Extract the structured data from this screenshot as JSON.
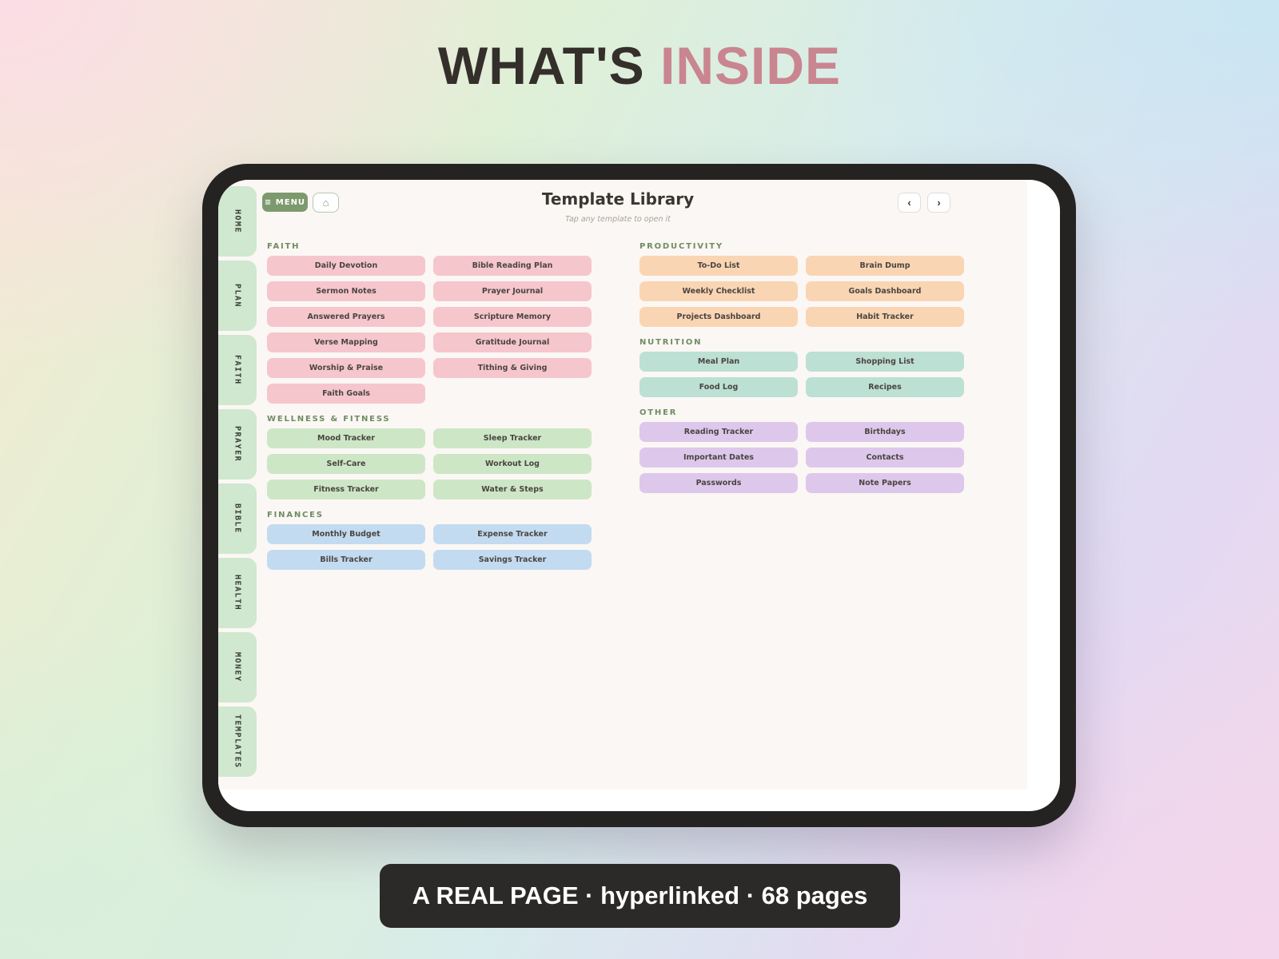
{
  "headline": {
    "main": "WHAT'S",
    "accent": "INSIDE"
  },
  "caption": "A REAL PAGE · hyperlinked · 68 pages",
  "colors": {
    "faith": "#f6c6cd",
    "wellness": "#cde7c6",
    "finances": "#c3dbf1",
    "productivity": "#fad5b3",
    "nutrition": "#bde0d4",
    "other": "#ddc8ec",
    "tab": "#cfe8cf",
    "accent_green": "#7c9a6e"
  },
  "tabs": [
    "HOME",
    "PLAN",
    "FAITH",
    "PRAYER",
    "BIBLE",
    "HEALTH",
    "MONEY",
    "TEMPLATES"
  ],
  "header": {
    "menu_label": "≡ MENU",
    "home_icon": "⌂",
    "title": "Template Library",
    "subtitle": "Tap any template to open it",
    "prev_icon": "‹",
    "next_icon": "›"
  },
  "sections": {
    "faith": {
      "title": "FAITH",
      "items": [
        "Daily Devotion",
        "Bible Reading Plan",
        "Sermon Notes",
        "Prayer Journal",
        "Answered Prayers",
        "Scripture Memory",
        "Verse Mapping",
        "Gratitude Journal",
        "Worship & Praise",
        "Tithing & Giving",
        "Faith Goals"
      ]
    },
    "wellness": {
      "title": "WELLNESS & FITNESS",
      "items": [
        "Mood Tracker",
        "Sleep Tracker",
        "Self-Care",
        "Workout Log",
        "Fitness Tracker",
        "Water & Steps"
      ]
    },
    "finances": {
      "title": "FINANCES",
      "items": [
        "Monthly Budget",
        "Expense Tracker",
        "Bills Tracker",
        "Savings Tracker"
      ]
    },
    "productivity": {
      "title": "PRODUCTIVITY",
      "items": [
        "To-Do List",
        "Brain Dump",
        "Weekly Checklist",
        "Goals Dashboard",
        "Projects Dashboard",
        "Habit Tracker"
      ]
    },
    "nutrition": {
      "title": "NUTRITION",
      "items": [
        "Meal Plan",
        "Shopping List",
        "Food Log",
        "Recipes"
      ]
    },
    "other": {
      "title": "OTHER",
      "items": [
        "Reading Tracker",
        "Birthdays",
        "Important Dates",
        "Contacts",
        "Passwords",
        "Note Papers"
      ]
    }
  }
}
